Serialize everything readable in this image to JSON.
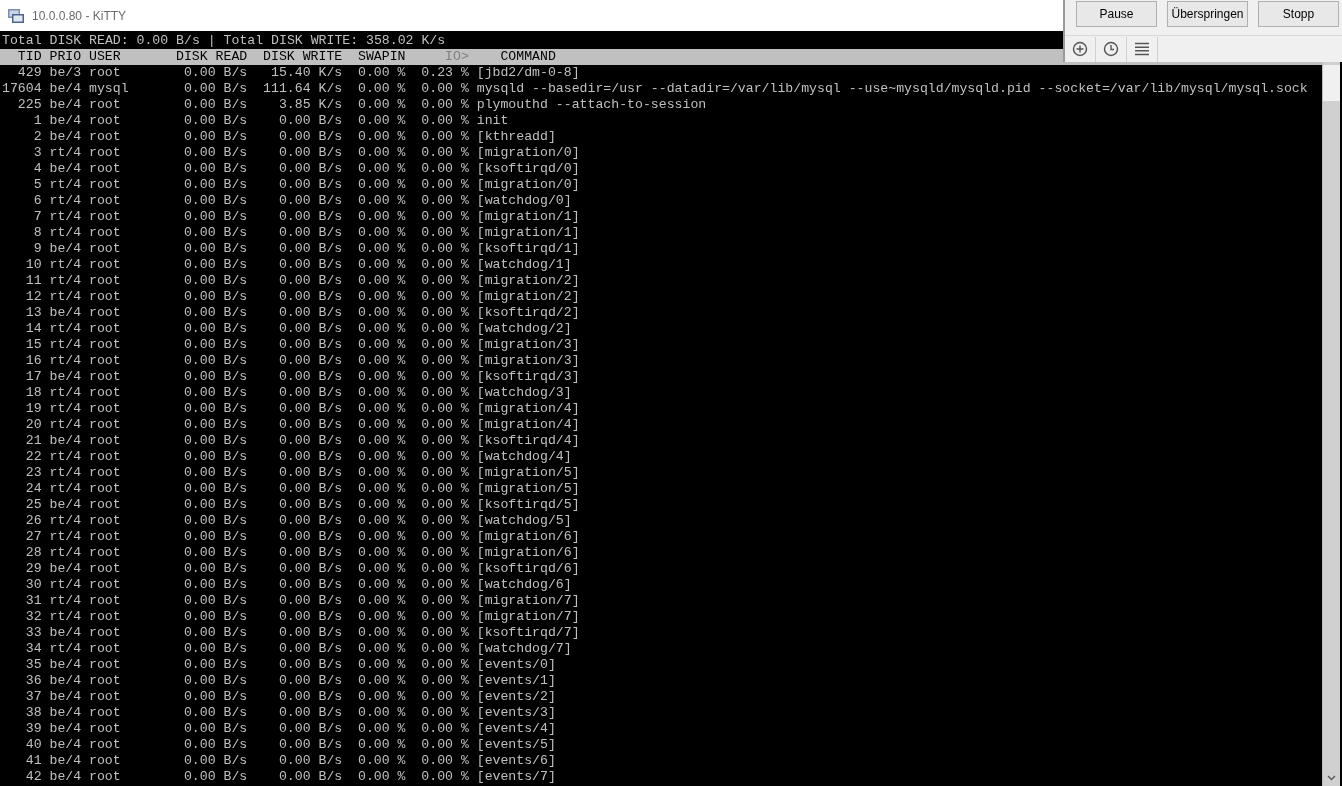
{
  "window": {
    "title": "10.0.0.80 - KiTTY"
  },
  "status_line": "Total DISK READ: 0.00 B/s | Total DISK WRITE: 358.02 K/s",
  "columns": [
    {
      "label": "TID",
      "selected": false
    },
    {
      "label": "PRIO",
      "selected": false
    },
    {
      "label": "USER",
      "selected": false
    },
    {
      "label": "DISK READ",
      "selected": false
    },
    {
      "label": "DISK WRITE",
      "selected": false
    },
    {
      "label": "SWAPIN",
      "selected": false
    },
    {
      "label": "IO>",
      "selected": true
    },
    {
      "label": "COMMAND",
      "selected": false
    }
  ],
  "rows": [
    [
      "429",
      "be/3",
      "root",
      "0.00 B/s",
      "15.40 K/s",
      "0.00 %",
      "0.23 %",
      "[jbd2/dm-0-8]"
    ],
    [
      "17604",
      "be/4",
      "mysql",
      "0.00 B/s",
      "111.64 K/s",
      "0.00 %",
      "0.00 %",
      "mysqld --basedir=/usr --datadir=/var/lib/mysql --use~mysqld/mysqld.pid --socket=/var/lib/mysql/mysql.sock"
    ],
    [
      "225",
      "be/4",
      "root",
      "0.00 B/s",
      "3.85 K/s",
      "0.00 %",
      "0.00 %",
      "plymouthd --attach-to-session"
    ],
    [
      "1",
      "be/4",
      "root",
      "0.00 B/s",
      "0.00 B/s",
      "0.00 %",
      "0.00 %",
      "init"
    ],
    [
      "2",
      "be/4",
      "root",
      "0.00 B/s",
      "0.00 B/s",
      "0.00 %",
      "0.00 %",
      "[kthreadd]"
    ],
    [
      "3",
      "rt/4",
      "root",
      "0.00 B/s",
      "0.00 B/s",
      "0.00 %",
      "0.00 %",
      "[migration/0]"
    ],
    [
      "4",
      "be/4",
      "root",
      "0.00 B/s",
      "0.00 B/s",
      "0.00 %",
      "0.00 %",
      "[ksoftirqd/0]"
    ],
    [
      "5",
      "rt/4",
      "root",
      "0.00 B/s",
      "0.00 B/s",
      "0.00 %",
      "0.00 %",
      "[migration/0]"
    ],
    [
      "6",
      "rt/4",
      "root",
      "0.00 B/s",
      "0.00 B/s",
      "0.00 %",
      "0.00 %",
      "[watchdog/0]"
    ],
    [
      "7",
      "rt/4",
      "root",
      "0.00 B/s",
      "0.00 B/s",
      "0.00 %",
      "0.00 %",
      "[migration/1]"
    ],
    [
      "8",
      "rt/4",
      "root",
      "0.00 B/s",
      "0.00 B/s",
      "0.00 %",
      "0.00 %",
      "[migration/1]"
    ],
    [
      "9",
      "be/4",
      "root",
      "0.00 B/s",
      "0.00 B/s",
      "0.00 %",
      "0.00 %",
      "[ksoftirqd/1]"
    ],
    [
      "10",
      "rt/4",
      "root",
      "0.00 B/s",
      "0.00 B/s",
      "0.00 %",
      "0.00 %",
      "[watchdog/1]"
    ],
    [
      "11",
      "rt/4",
      "root",
      "0.00 B/s",
      "0.00 B/s",
      "0.00 %",
      "0.00 %",
      "[migration/2]"
    ],
    [
      "12",
      "rt/4",
      "root",
      "0.00 B/s",
      "0.00 B/s",
      "0.00 %",
      "0.00 %",
      "[migration/2]"
    ],
    [
      "13",
      "be/4",
      "root",
      "0.00 B/s",
      "0.00 B/s",
      "0.00 %",
      "0.00 %",
      "[ksoftirqd/2]"
    ],
    [
      "14",
      "rt/4",
      "root",
      "0.00 B/s",
      "0.00 B/s",
      "0.00 %",
      "0.00 %",
      "[watchdog/2]"
    ],
    [
      "15",
      "rt/4",
      "root",
      "0.00 B/s",
      "0.00 B/s",
      "0.00 %",
      "0.00 %",
      "[migration/3]"
    ],
    [
      "16",
      "rt/4",
      "root",
      "0.00 B/s",
      "0.00 B/s",
      "0.00 %",
      "0.00 %",
      "[migration/3]"
    ],
    [
      "17",
      "be/4",
      "root",
      "0.00 B/s",
      "0.00 B/s",
      "0.00 %",
      "0.00 %",
      "[ksoftirqd/3]"
    ],
    [
      "18",
      "rt/4",
      "root",
      "0.00 B/s",
      "0.00 B/s",
      "0.00 %",
      "0.00 %",
      "[watchdog/3]"
    ],
    [
      "19",
      "rt/4",
      "root",
      "0.00 B/s",
      "0.00 B/s",
      "0.00 %",
      "0.00 %",
      "[migration/4]"
    ],
    [
      "20",
      "rt/4",
      "root",
      "0.00 B/s",
      "0.00 B/s",
      "0.00 %",
      "0.00 %",
      "[migration/4]"
    ],
    [
      "21",
      "be/4",
      "root",
      "0.00 B/s",
      "0.00 B/s",
      "0.00 %",
      "0.00 %",
      "[ksoftirqd/4]"
    ],
    [
      "22",
      "rt/4",
      "root",
      "0.00 B/s",
      "0.00 B/s",
      "0.00 %",
      "0.00 %",
      "[watchdog/4]"
    ],
    [
      "23",
      "rt/4",
      "root",
      "0.00 B/s",
      "0.00 B/s",
      "0.00 %",
      "0.00 %",
      "[migration/5]"
    ],
    [
      "24",
      "rt/4",
      "root",
      "0.00 B/s",
      "0.00 B/s",
      "0.00 %",
      "0.00 %",
      "[migration/5]"
    ],
    [
      "25",
      "be/4",
      "root",
      "0.00 B/s",
      "0.00 B/s",
      "0.00 %",
      "0.00 %",
      "[ksoftirqd/5]"
    ],
    [
      "26",
      "rt/4",
      "root",
      "0.00 B/s",
      "0.00 B/s",
      "0.00 %",
      "0.00 %",
      "[watchdog/5]"
    ],
    [
      "27",
      "rt/4",
      "root",
      "0.00 B/s",
      "0.00 B/s",
      "0.00 %",
      "0.00 %",
      "[migration/6]"
    ],
    [
      "28",
      "rt/4",
      "root",
      "0.00 B/s",
      "0.00 B/s",
      "0.00 %",
      "0.00 %",
      "[migration/6]"
    ],
    [
      "29",
      "be/4",
      "root",
      "0.00 B/s",
      "0.00 B/s",
      "0.00 %",
      "0.00 %",
      "[ksoftirqd/6]"
    ],
    [
      "30",
      "rt/4",
      "root",
      "0.00 B/s",
      "0.00 B/s",
      "0.00 %",
      "0.00 %",
      "[watchdog/6]"
    ],
    [
      "31",
      "rt/4",
      "root",
      "0.00 B/s",
      "0.00 B/s",
      "0.00 %",
      "0.00 %",
      "[migration/7]"
    ],
    [
      "32",
      "rt/4",
      "root",
      "0.00 B/s",
      "0.00 B/s",
      "0.00 %",
      "0.00 %",
      "[migration/7]"
    ],
    [
      "33",
      "be/4",
      "root",
      "0.00 B/s",
      "0.00 B/s",
      "0.00 %",
      "0.00 %",
      "[ksoftirqd/7]"
    ],
    [
      "34",
      "rt/4",
      "root",
      "0.00 B/s",
      "0.00 B/s",
      "0.00 %",
      "0.00 %",
      "[watchdog/7]"
    ],
    [
      "35",
      "be/4",
      "root",
      "0.00 B/s",
      "0.00 B/s",
      "0.00 %",
      "0.00 %",
      "[events/0]"
    ],
    [
      "36",
      "be/4",
      "root",
      "0.00 B/s",
      "0.00 B/s",
      "0.00 %",
      "0.00 %",
      "[events/1]"
    ],
    [
      "37",
      "be/4",
      "root",
      "0.00 B/s",
      "0.00 B/s",
      "0.00 %",
      "0.00 %",
      "[events/2]"
    ],
    [
      "38",
      "be/4",
      "root",
      "0.00 B/s",
      "0.00 B/s",
      "0.00 %",
      "0.00 %",
      "[events/3]"
    ],
    [
      "39",
      "be/4",
      "root",
      "0.00 B/s",
      "0.00 B/s",
      "0.00 %",
      "0.00 %",
      "[events/4]"
    ],
    [
      "40",
      "be/4",
      "root",
      "0.00 B/s",
      "0.00 B/s",
      "0.00 %",
      "0.00 %",
      "[events/5]"
    ],
    [
      "41",
      "be/4",
      "root",
      "0.00 B/s",
      "0.00 B/s",
      "0.00 %",
      "0.00 %",
      "[events/6]"
    ],
    [
      "42",
      "be/4",
      "root",
      "0.00 B/s",
      "0.00 B/s",
      "0.00 %",
      "0.00 %",
      "[events/7]"
    ]
  ],
  "overlay": {
    "buttons": [
      "Pause",
      "Überspringen",
      "Stopp"
    ]
  }
}
